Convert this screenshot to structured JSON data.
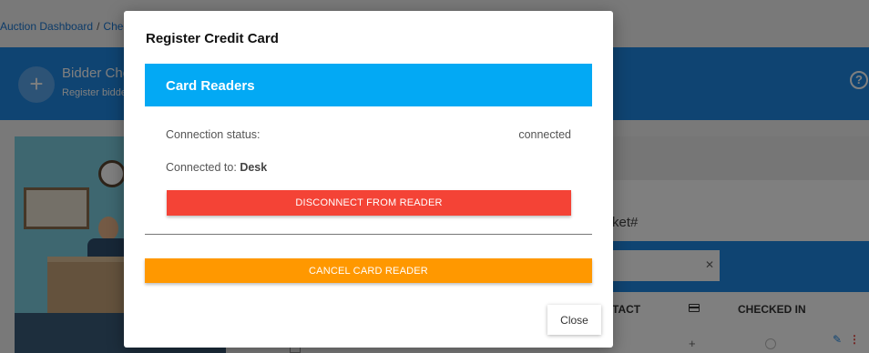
{
  "background": {
    "breadcrumb": {
      "items": [
        "Auction Dashboard",
        "Chec"
      ],
      "separator": "/"
    },
    "header": {
      "title": "Bidder Che",
      "subtitle": "Register bidde",
      "add_icon": "plus-icon",
      "help_icon": "help-circle-icon"
    },
    "table": {
      "search_partial": "ket#",
      "columns": [
        "TACT",
        "CHECKED IN"
      ],
      "card_column_icon": "credit-card-icon",
      "row_actions": {
        "add_icon": "plus-icon",
        "edit_icon": "pencil-icon",
        "more_icon": "more-vert-icon"
      }
    }
  },
  "modal": {
    "title": "Register Credit Card",
    "section_title": "Card Readers",
    "connection_status_label": "Connection status:",
    "connection_status_value": "connected",
    "connected_to_label": "Connected to:",
    "connected_to_value": "Desk",
    "disconnect_label": "DISCONNECT FROM READER",
    "cancel_label": "CANCEL CARD READER",
    "close_label": "Close"
  },
  "colors": {
    "header_blue": "#1e88e5",
    "section_blue": "#03a9f4",
    "danger_red": "#f44336",
    "warning_orange": "#ff9800"
  }
}
